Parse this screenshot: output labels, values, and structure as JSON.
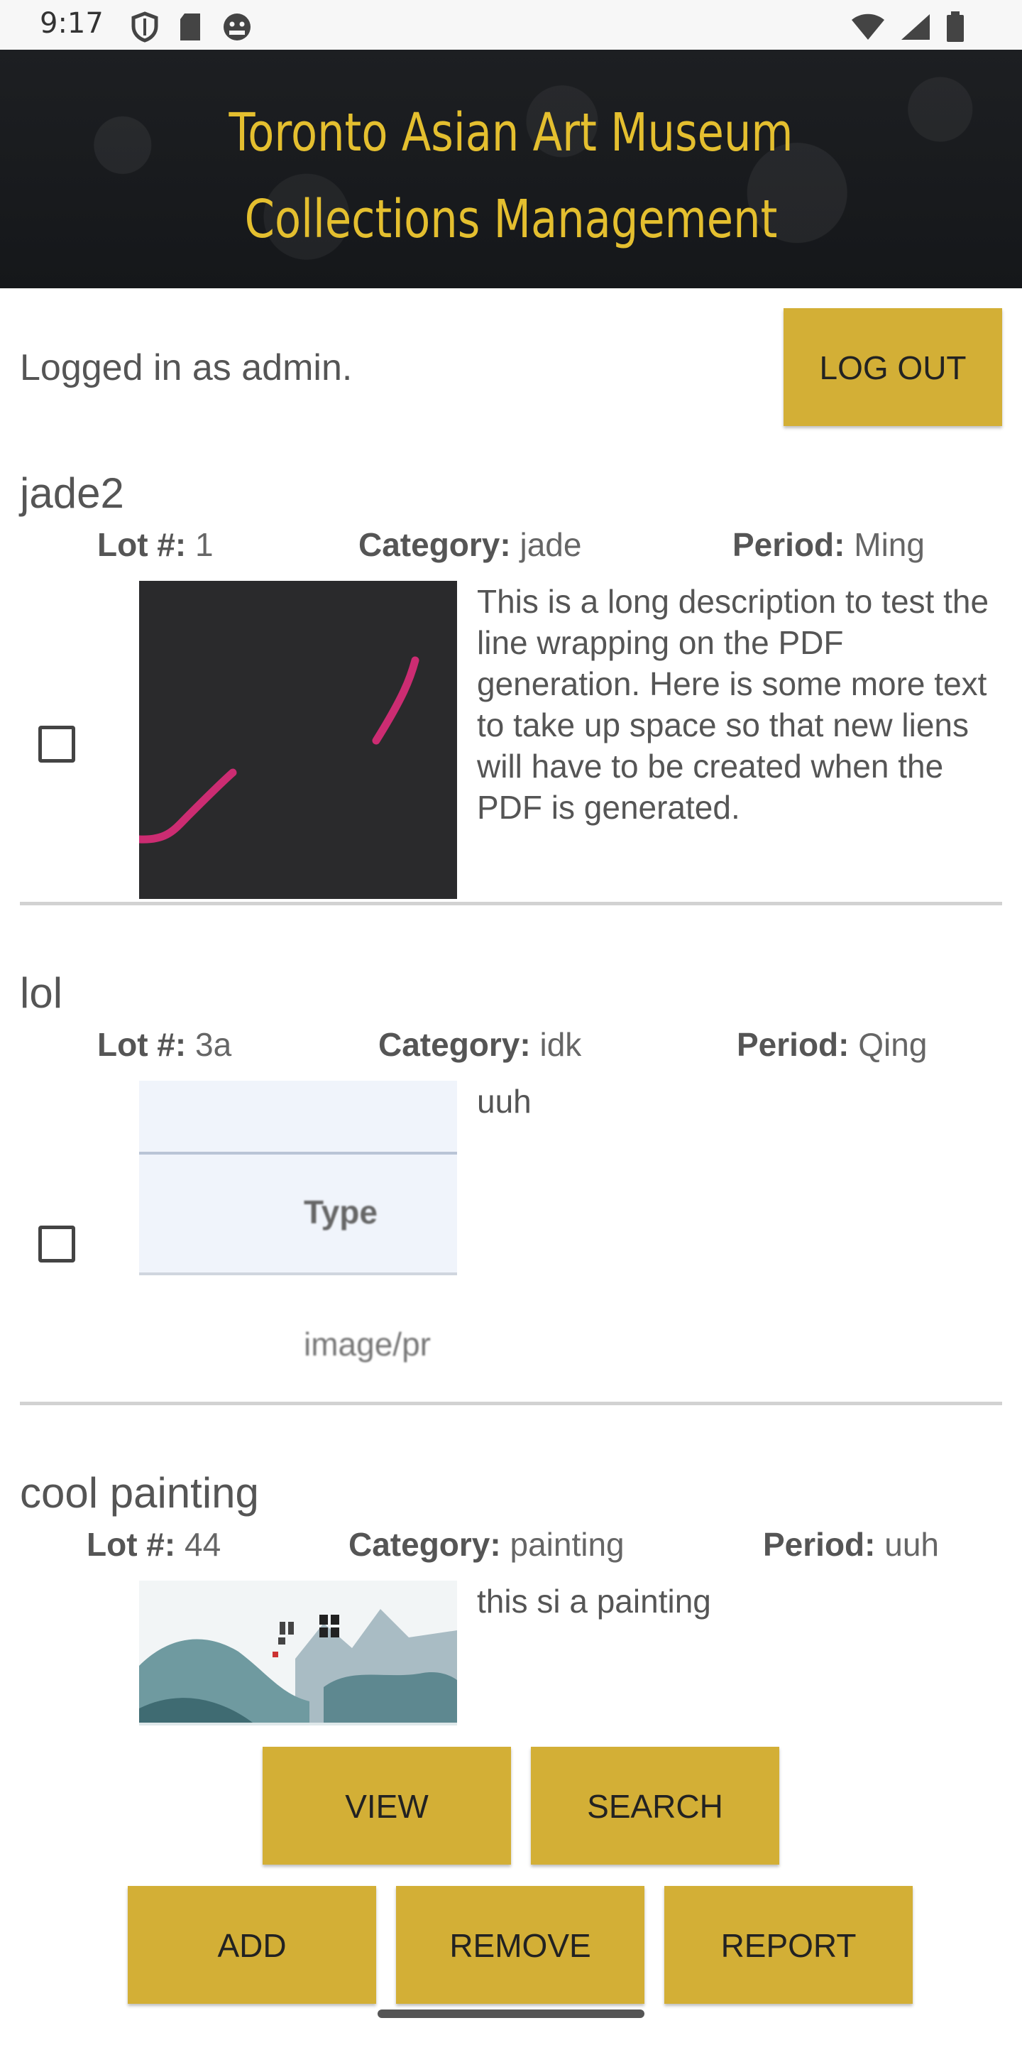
{
  "status_bar": {
    "time": "9:17"
  },
  "header": {
    "title": "Toronto Asian Art Museum Collections Management"
  },
  "session": {
    "logged_in_text": "Logged in as admin.",
    "logout_label": "LOG OUT"
  },
  "labels": {
    "lot": "Lot #:",
    "category": "Category:",
    "period": "Period:"
  },
  "items": [
    {
      "title": "jade2",
      "lot": "1",
      "category": "jade",
      "period": "Ming",
      "description": "This is a long description to test the line wrapping on the PDF generation. Here is some more text to take up space so that new liens will have to be created when the PDF is generated.",
      "checked": false
    },
    {
      "title": "lol",
      "lot": "3a",
      "category": "idk",
      "period": "Qing",
      "description": "uuh",
      "checked": false,
      "thumbnail_texts": [
        "Type",
        "image/pr"
      ]
    },
    {
      "title": "cool painting",
      "lot": "44",
      "category": "painting",
      "period": "uuh",
      "description": "this si a painting",
      "checked": false
    }
  ],
  "buttons": {
    "view": "VIEW",
    "search": "SEARCH",
    "add": "ADD",
    "remove": "REMOVE",
    "report": "REPORT"
  },
  "colors": {
    "accent": "#d3af36",
    "header_title": "#e4bf2f",
    "header_bg": "#1a1c1f"
  }
}
